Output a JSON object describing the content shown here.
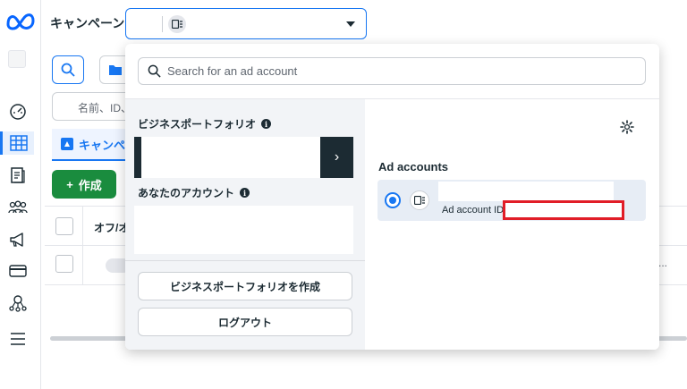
{
  "header": {
    "title": "キャンペーン",
    "account_selector": {
      "value": ""
    }
  },
  "popup": {
    "search_placeholder": "Search for an ad account",
    "left": {
      "business_portfolio_label": "ビジネスポートフォリオ",
      "your_accounts_label": "あなたのアカウント",
      "create_portfolio_button": "ビジネスポートフォリオを作成",
      "logout_button": "ログアウト",
      "arrow": "›"
    },
    "right": {
      "heading": "Ad accounts",
      "account": {
        "id_label": "Ad account ID:",
        "selected": true
      }
    }
  },
  "background": {
    "filter_placeholder": "名前、ID、",
    "tab_label": "キャンペ",
    "create_button": "作成",
    "create_plus": "+",
    "column_onoff": "オフ/オ",
    "row_ellipsis": "..."
  },
  "colors": {
    "accent": "#1877f2",
    "create_green": "#1a8c3e",
    "redaction": "#e11d27",
    "dark": "#1c2b33"
  }
}
